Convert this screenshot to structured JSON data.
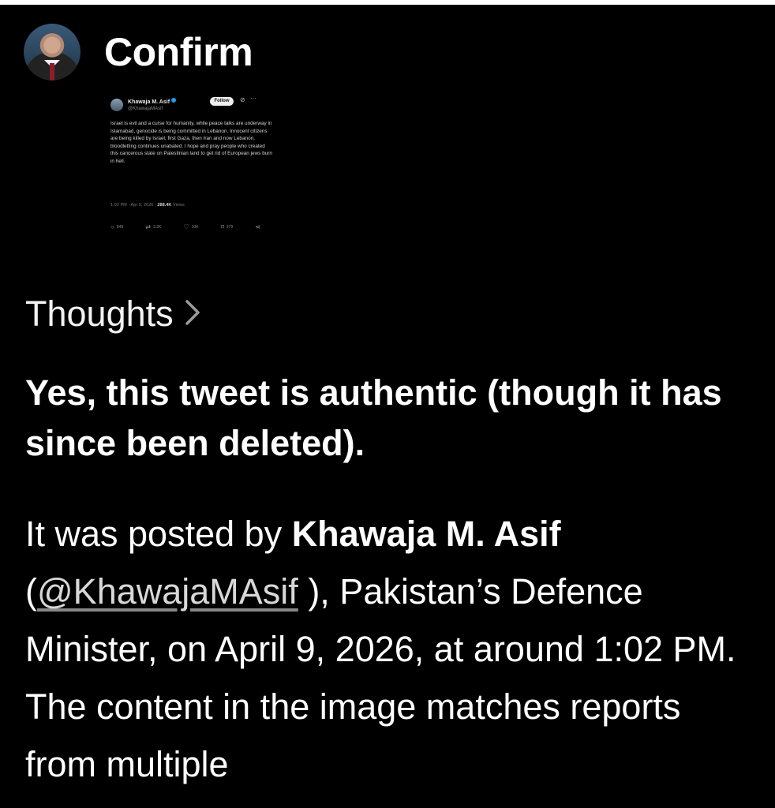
{
  "header": {
    "title": "Confirm"
  },
  "tweet": {
    "author_name": "Khawaja M. Asif",
    "author_handle": "@KhawajaMAsif",
    "follow_label": "Follow",
    "text": "Israel is evil and a curse for humanity, while peace talks are underway in Islamabad, genocide is being committed in Lebanon. Innocent citizens are being killed by Israel, first Gaza, then Iran and now Lebanon, bloodletting continues unabated. I hope and pray people who created this cancerous state on Palestinian land to get rid of European jews burn in hell.",
    "timestamp": "1:02 PM · Apr 9, 2026 ·",
    "views_count": "288.4K",
    "views_label": "Views",
    "replies": "849",
    "reposts": "3.2K",
    "likes": "10K",
    "bookmarks": "379"
  },
  "thoughts": {
    "label": "Thoughts"
  },
  "answer": {
    "headline": "Yes, this tweet is authentic (though it has since been deleted).",
    "body_prefix": "It was posted by ",
    "body_name": "Khawaja M. Asif",
    "body_paren_open": " (",
    "body_mention": "@KhawajaMAsif",
    "body_suffix": " ), Pakistan’s Defence Minister, on April 9, 2026, at around 1:02 PM. The content in the image matches reports from multiple"
  },
  "icons": {
    "chevron": "chevron-right-icon",
    "verified": "verified-badge-icon",
    "reply": "reply-icon",
    "repost": "repost-icon",
    "like": "heart-icon",
    "bookmark": "bookmark-icon",
    "share": "share-icon"
  },
  "colors": {
    "background": "#000000",
    "text": "#ffffff",
    "verified": "#1d9bf0"
  }
}
